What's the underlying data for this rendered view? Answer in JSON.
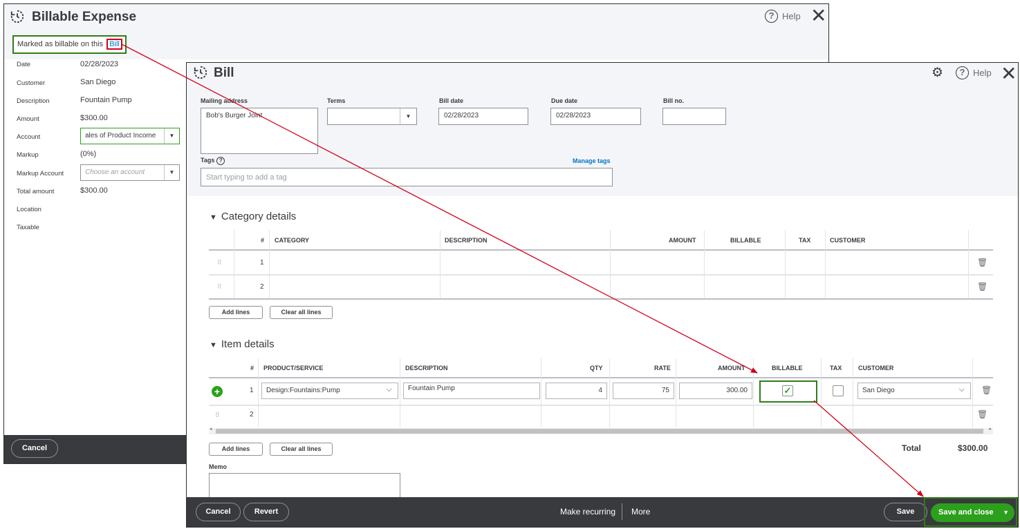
{
  "billable_expense": {
    "title": "Billable Expense",
    "help": "Help",
    "marked_prefix": "Marked as billable on this",
    "bill_link": "Bill",
    "fields": [
      {
        "label": "Date",
        "value": "02/28/2023"
      },
      {
        "label": "Customer",
        "value": "San Diego"
      },
      {
        "label": "Description",
        "value": "Fountain Pump"
      },
      {
        "label": "Amount",
        "value": "$300.00"
      },
      {
        "label": "Account",
        "value": "ales of Product Income"
      },
      {
        "label": "Markup",
        "value": "(0%)"
      },
      {
        "label": "Markup Account",
        "placeholder": "Choose an account"
      },
      {
        "label": "Total amount",
        "value": "$300.00"
      },
      {
        "label": "Location",
        "value": ""
      },
      {
        "label": "Taxable",
        "value": ""
      }
    ],
    "cancel": "Cancel"
  },
  "bill": {
    "title": "Bill",
    "help": "Help",
    "mailing_address_label": "Mailing address",
    "mailing_address": "Bob's Burger Joint",
    "terms_label": "Terms",
    "terms_value": "",
    "bill_date_label": "Bill date",
    "bill_date": "02/28/2023",
    "due_date_label": "Due date",
    "due_date": "02/28/2023",
    "bill_no_label": "Bill no.",
    "bill_no": "",
    "tags_label": "Tags",
    "manage_tags": "Manage tags",
    "tags_placeholder": "Start typing to add a tag",
    "category_section": "Category details",
    "category_headers": [
      "#",
      "CATEGORY",
      "DESCRIPTION",
      "AMOUNT",
      "BILLABLE",
      "TAX",
      "CUSTOMER"
    ],
    "category_rows": [
      "1",
      "2"
    ],
    "add_lines": "Add lines",
    "clear_all_lines": "Clear all lines",
    "item_section": "Item details",
    "item_headers": [
      "#",
      "PRODUCT/SERVICE",
      "DESCRIPTION",
      "QTY",
      "RATE",
      "AMOUNT",
      "BILLABLE",
      "TAX",
      "CUSTOMER"
    ],
    "item_rows": [
      {
        "num": "1",
        "product": "Design:Fountains:Pump",
        "description": "Fountain Pump",
        "qty": "4",
        "rate": "75",
        "amount": "300.00",
        "billable": true,
        "tax": false,
        "customer": "San Diego"
      },
      {
        "num": "2",
        "product": "",
        "description": "",
        "qty": "",
        "rate": "",
        "amount": "",
        "billable": false,
        "tax": false,
        "customer": ""
      }
    ],
    "total_label": "Total",
    "total_value": "$300.00",
    "memo_label": "Memo",
    "footer": {
      "cancel": "Cancel",
      "revert": "Revert",
      "make_recurring": "Make recurring",
      "more": "More",
      "save": "Save",
      "save_and_close": "Save and close"
    }
  },
  "colors": {
    "annotation_red": "#d0021b",
    "annotation_green": "#2e7d1a",
    "qb_green": "#2ca01c",
    "link_blue": "#0077c5",
    "footer_dark": "#393a3d"
  }
}
